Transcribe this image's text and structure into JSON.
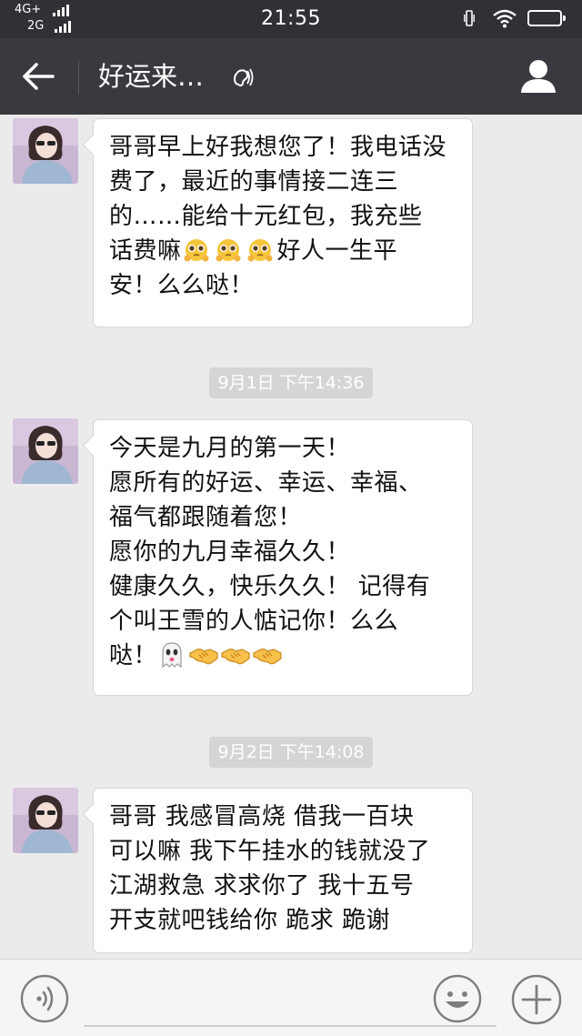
{
  "status_bar": {
    "network_top": "4G+",
    "network_bottom": "2G",
    "time": "21:55"
  },
  "header": {
    "title": "好运来…",
    "icons": [
      "back-arrow-icon",
      "earpiece-icon",
      "profile-icon"
    ]
  },
  "messages": [
    {
      "sender": "avatar",
      "lines": [
        [
          "哥哥早上好我想您了！我电话没"
        ],
        [
          "费了，最近的事情接二连三"
        ],
        [
          "的……能给十元红包，我充些"
        ],
        [
          "话费嘛",
          "{emoji:pleading}",
          "{emoji:pleading}",
          "{emoji:pleading}",
          "好人一生平"
        ],
        [
          "安！么么哒！"
        ]
      ]
    },
    {
      "sender": "avatar",
      "lines": [
        [
          "今天是九月的第一天！"
        ],
        [
          "愿所有的好运、幸运、幸福、"
        ],
        [
          "福气都跟随着您！"
        ],
        [
          "愿你的九月幸福久久！"
        ],
        [
          "健康久久，快乐久久！ 记得有"
        ],
        [
          "个叫王雪的人惦记你！么么"
        ],
        [
          "哒！",
          "{emoji:ghost}",
          "{emoji:handshake}",
          "{emoji:handshake}",
          "{emoji:handshake}"
        ]
      ]
    },
    {
      "sender": "avatar",
      "lines": [
        [
          "哥哥 我感冒高烧  借我一百块"
        ],
        [
          "可以嘛 我下午挂水的钱就没了"
        ],
        [
          "江湖救急  求求你了  我十五号"
        ],
        [
          "开支就吧钱给你  跪求  跪谢"
        ]
      ]
    }
  ],
  "timestamps": [
    "9月1日 下午14:36",
    "9月2日 下午14:08"
  ],
  "input_bar": {
    "text_value": "",
    "icons": [
      "voice-icon",
      "emoji-icon",
      "plus-icon"
    ]
  },
  "colors": {
    "status_bar_bg": "#2f3135",
    "title_bar_bg": "#393a3f",
    "chat_bg": "#ebebeb",
    "bubble_bg": "#ffffff",
    "timestamp_bg": "#d5d5d5"
  }
}
